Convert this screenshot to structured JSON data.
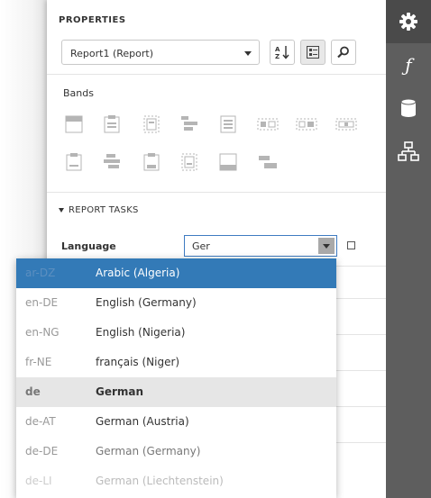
{
  "properties": {
    "title": "PROPERTIES",
    "selected_component": "Report1 (Report)"
  },
  "bands": {
    "label": "Bands",
    "icons": [
      "page-header-band-icon",
      "report-header-band-icon",
      "group-header-band-icon",
      "detail-band-icon",
      "detail-report-band-icon",
      "vertical-header-band-icon",
      "vertical-details-band-icon",
      "vertical-total-band-icon",
      "sub-band-icon",
      "group-footer-band-icon",
      "report-footer-band-icon",
      "page-footer-band-icon",
      "bottom-margin-band-icon",
      "top-margin-band-icon"
    ]
  },
  "report_tasks": {
    "label": "REPORT TASKS",
    "language_label": "Language",
    "language_value": "Ger"
  },
  "dropdown": {
    "items": [
      {
        "code": "ar-DZ",
        "name": "Arabic (Algeria)"
      },
      {
        "code": "en-DE",
        "name": "English (Germany)"
      },
      {
        "code": "en-NG",
        "name": "English (Nigeria)"
      },
      {
        "code": "fr-NE",
        "name": "français (Niger)"
      },
      {
        "code": "de",
        "name": "German"
      },
      {
        "code": "de-AT",
        "name": "German (Austria)"
      },
      {
        "code": "de-DE",
        "name": "German (Germany)"
      },
      {
        "code": "de-LI",
        "name": "German (Liechtenstein)"
      }
    ],
    "selected_index": 0,
    "highlight_index": 4
  },
  "sidebar_tabs": [
    "properties-gear-icon",
    "expressions-function-icon",
    "field-list-database-icon",
    "report-explorer-icon"
  ],
  "colors": {
    "accent": "#337ab7",
    "sidebar": "#5e5e5e",
    "highlight": "#e6e6e6"
  }
}
